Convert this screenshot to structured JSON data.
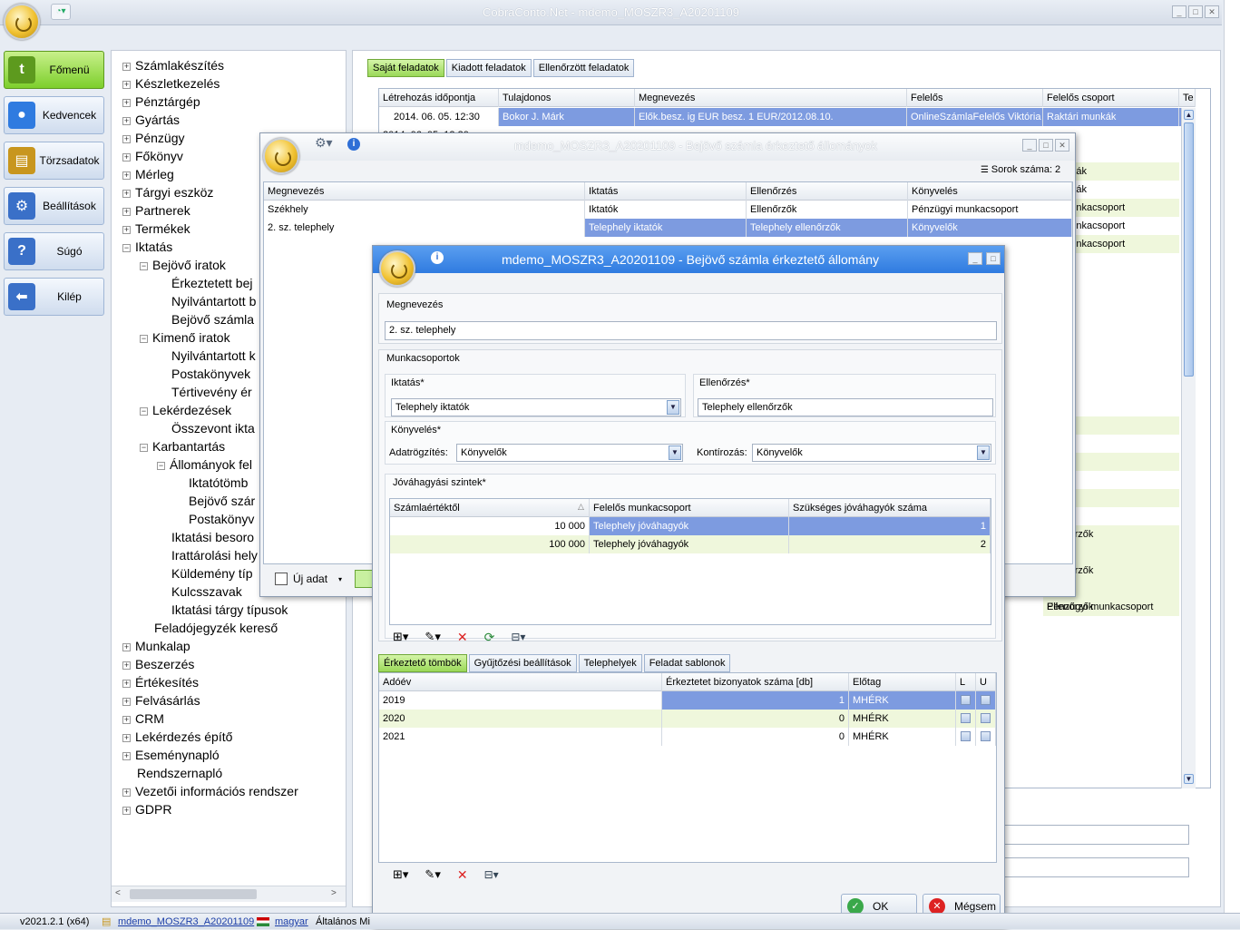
{
  "window": {
    "title": "CobraConto.Net - mdemo_MOSZR3_A20201109"
  },
  "nav": [
    {
      "label": "Főmenü",
      "icon": "home-menu-icon",
      "color": "#5d9a1e"
    },
    {
      "label": "Kedvencek",
      "icon": "map-pin-icon",
      "color": "#2f7be0"
    },
    {
      "label": "Törzsadatok",
      "icon": "clipboard-icon",
      "color": "#c8961e"
    },
    {
      "label": "Beállítások",
      "icon": "gear-icon",
      "color": "#3a70c8"
    },
    {
      "label": "Súgó",
      "icon": "help-icon",
      "color": "#3a70c8"
    },
    {
      "label": "Kilép",
      "icon": "back-arrow-icon",
      "color": "#3a70c8"
    }
  ],
  "tree": [
    "Számlakészítés",
    "Készletkezelés",
    "Pénztárgép",
    "Gyártás",
    "Pénzügy",
    "Főkönyv",
    "Mérleg",
    "Tárgyi eszköz",
    "Partnerek",
    "Termékek",
    "Iktatás",
    "Bejövő iratok",
    "Érkeztetett bej",
    "Nyilvántartott b",
    "Bejövő számla",
    "Kimenő iratok",
    "Nyilvántartott k",
    "Postakönyvek",
    "Tértivevény ér",
    "Lekérdezések",
    "Összevont ikta",
    "Karbantartás",
    "Állományok fel",
    "Iktatótömb",
    "Bejövő szár",
    "Postakönyv",
    "Iktatási besoro",
    "Irattárolási hely",
    "Küldemény típ",
    "Kulcsszavak",
    "Iktatási tárgy típusok",
    "Feladójegyzék kereső",
    "Munkalap",
    "Beszerzés",
    "Értékesítés",
    "Felvásárlás",
    "CRM",
    "Lekérdezés építő",
    "Eseménynapló",
    "Rendszernapló",
    "Vezetői információs rendszer",
    "GDPR"
  ],
  "tasks": {
    "tabs": [
      "Saját feladatok",
      "Kiadott feladatok",
      "Ellenőrzött feladatok"
    ],
    "columns": [
      "Létrehozás időpontja",
      "Tulajdonos",
      "Megnevezés",
      "Felelős",
      "Felelős csoport",
      "Te"
    ],
    "row1": [
      "2014. 06. 05. 12:30",
      "Bokor J. Márk",
      "Elők.besz. ig EUR besz. 1 EUR/2012.08.10.",
      "OnlineSzámlaFelelős Viktória",
      "Raktári munkák"
    ],
    "row2_partial": "2014. 06. 05. 12:30",
    "right_values": [
      "i munkák",
      "i munkák",
      "ygi munkacsoport",
      "ygi munkacsoport",
      "ygi munkacsoport",
      "agyók",
      "agyók",
      "agyók",
      "gyók",
      "őrzők",
      "őrzők",
      "őrzők",
      "Ellenőrzők",
      "Ellenőrzők",
      "Ellenőrzők",
      "Ellenőrzők",
      "Ellenőrzők",
      "iktória",
      "iktória",
      "iktória",
      "iktória",
      "Pénzügyi munkacsoport"
    ]
  },
  "dialog1": {
    "title": "mdemo_MOSZR3_A20201109 - Bejövő számla érkeztető állományok",
    "rowcount": "Sorok száma: 2",
    "columns": [
      "Megnevezés",
      "Iktatás",
      "Ellenőrzés",
      "Könyvelés"
    ],
    "rows": [
      [
        "Székhely",
        "Iktatók",
        "Ellenőrzők",
        "Pénzügyi munkacsoport"
      ],
      [
        "2. sz. telephely",
        "Telephely iktatók",
        "Telephely ellenőrzők",
        "Könyvelők"
      ]
    ],
    "new_label": "Új adat"
  },
  "dialog2": {
    "title": "mdemo_MOSZR3_A20201109 - Bejövő számla érkeztető állomány",
    "name_label": "Megnevezés",
    "name_value": "2. sz. telephely",
    "groups_label": "Munkacsoportok",
    "iktatas_label": "Iktatás*",
    "iktatas_value": "Telephely iktatók",
    "ellenorzes_label": "Ellenőrzés*",
    "ellenorzes_value": "Telephely ellenőrzők",
    "konyveles_label": "Könyvelés*",
    "adatrogzites_label": "Adatrögzítés:",
    "adatrogzites_value": "Könyvelők",
    "kontirozas_label": "Kontírozás:",
    "kontirozas_value": "Könyvelők",
    "approval_label": "Jóváhagyási szintek*",
    "approval_columns": [
      "Számlaértéktől",
      "Felelős munkacsoport",
      "Szükséges jóváhagyók száma"
    ],
    "approval_rows": [
      [
        "10 000",
        "Telephely jóváhagyók",
        "1"
      ],
      [
        "100 000",
        "Telephely jóváhagyók",
        "2"
      ]
    ],
    "tabs": [
      "Érkeztető tömbök",
      "Gyűjtőzési beállítások",
      "Telephelyek",
      "Feladat sablonok"
    ],
    "block_columns": [
      "Adóév",
      "Érkeztetet bizonyatok száma [db]",
      "Előtag",
      "L",
      "U"
    ],
    "block_rows": [
      [
        "2019",
        "1",
        "MHÉRK"
      ],
      [
        "2020",
        "0",
        "MHÉRK"
      ],
      [
        "2021",
        "0",
        "MHÉRK"
      ]
    ],
    "ok_label": "OK",
    "cancel_label": "Mégsem"
  },
  "status": {
    "version": "v2021.2.1 (x64)",
    "db": "mdemo_MOSZR3_A20201109",
    "lang": "magyar",
    "company": "Általános Mi"
  },
  "colors": {
    "accent_green": "#9ad858",
    "selection": "#7d9be0",
    "title_blue": "#2f7be0"
  }
}
